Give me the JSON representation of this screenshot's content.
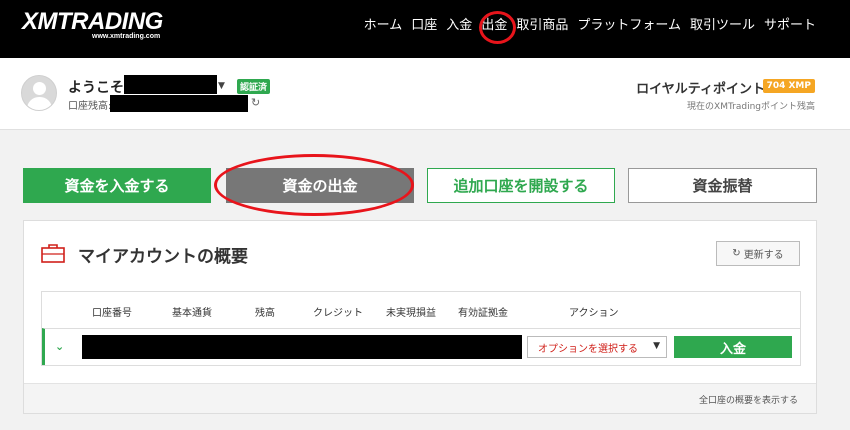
{
  "header": {
    "logo": "XMTRADING",
    "logo_sub": "www.xmtrading.com",
    "nav": [
      "ホーム",
      "口座",
      "入金",
      "出金",
      "取引商品",
      "プラットフォーム",
      "取引ツール",
      "サポート"
    ]
  },
  "profile": {
    "welcome": "ようこそ",
    "verified": "認証済",
    "balance_label": "口座残高:",
    "royalty_title": "ロイヤルティポイント",
    "xmp": "704 XMP",
    "points_sub": "現在のXMTradingポイント残高"
  },
  "actions": {
    "deposit": "資金を入金する",
    "withdraw": "資金の出金",
    "additional": "追加口座を開設する",
    "transfer": "資金振替"
  },
  "overview": {
    "title": "マイアカウントの概要",
    "refresh": "更新する",
    "columns": [
      "口座番号",
      "基本通貨",
      "残高",
      "クレジット",
      "未実現損益",
      "有効証拠金",
      "アクション"
    ],
    "select_option": "オプションを選択する",
    "row_deposit": "入金",
    "footer_link": "全口座の概要を表示する"
  },
  "colors": {
    "green": "#2fa84f",
    "highlight": "#e8141b",
    "gold": "#f5a623"
  }
}
